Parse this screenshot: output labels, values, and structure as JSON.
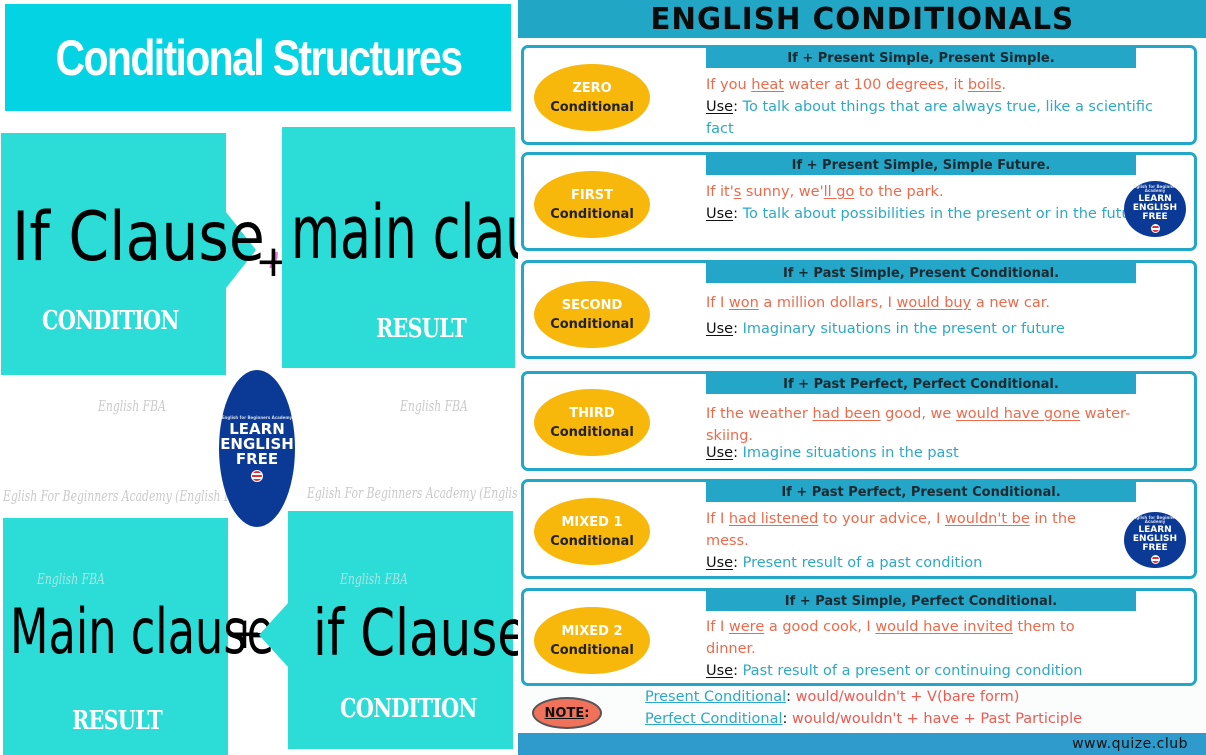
{
  "left": {
    "title": "Conditional Structures",
    "top_row": {
      "if_clause": "If Clause",
      "comma": ",",
      "plus": "+",
      "main_clause": "main clause.",
      "if_tag": "CONDITION",
      "main_tag": "RESULT"
    },
    "bottom_row": {
      "main_clause": "Main clause",
      "plus": "+",
      "if_clause": "if Clause .",
      "main_tag": "RESULT",
      "if_tag": "CONDITION"
    },
    "watermarks": {
      "short": "English FBA",
      "long": "Eglish For Beginners Academy (English FBA)"
    },
    "badge": {
      "tiny": "English for Beginners Academy",
      "line1": "LEARN",
      "line2": "ENGLISH",
      "line3": "FREE"
    }
  },
  "right": {
    "header": "ENGLISH CONDITIONALS",
    "use_label": "Use",
    "cards": [
      {
        "name": "zero",
        "type": "ZERO",
        "label": "Conditional",
        "formula": "If + Present Simple, Present Simple.",
        "example": [
          {
            "t": "If you "
          },
          {
            "t": "heat",
            "u": true
          },
          {
            "t": " water at 100 degrees, it "
          },
          {
            "t": "boils",
            "u": true
          },
          {
            "t": "."
          }
        ],
        "use": "To talk about things that are always true, like a scientific fact"
      },
      {
        "name": "first",
        "type": "FIRST",
        "label": "Conditional",
        "formula": "If + Present Simple, Simple Future.",
        "example": [
          {
            "t": "If it'"
          },
          {
            "t": "s",
            "u": true
          },
          {
            "t": " sunny, we'"
          },
          {
            "t": "ll go",
            "u": true
          },
          {
            "t": " to the park."
          }
        ],
        "use": "To talk about possibilities in the present or in the future"
      },
      {
        "name": "second",
        "type": "SECOND",
        "label": "Conditional",
        "formula": "If + Past Simple, Present Conditional.",
        "example": [
          {
            "t": "If I "
          },
          {
            "t": "won",
            "u": true
          },
          {
            "t": " a million dollars, I "
          },
          {
            "t": "would buy",
            "u": true
          },
          {
            "t": " a new car."
          }
        ],
        "use": "Imaginary situations in the present or future"
      },
      {
        "name": "third",
        "type": "THIRD",
        "label": "Conditional",
        "formula": "If + Past Perfect, Perfect Conditional.",
        "example": [
          {
            "t": "If the weather "
          },
          {
            "t": "had been",
            "u": true
          },
          {
            "t": " good, we "
          },
          {
            "t": "would have gone",
            "u": true
          },
          {
            "t": " water-skiing."
          }
        ],
        "use": "Imagine situations in the past"
      },
      {
        "name": "mixed-1",
        "type": "MIXED 1",
        "label": "Conditional",
        "formula": "If + Past Perfect, Present Conditional.",
        "example": [
          {
            "t": "If I "
          },
          {
            "t": "had listened",
            "u": true
          },
          {
            "t": " to your advice, I "
          },
          {
            "t": "wouldn't be",
            "u": true
          },
          {
            "t": " in the mess."
          }
        ],
        "use": "Present result of a past condition"
      },
      {
        "name": "mixed-2",
        "type": "MIXED 2",
        "label": "Conditional",
        "formula": "If + Past Simple, Perfect Conditional.",
        "example": [
          {
            "t": "If I "
          },
          {
            "t": "were",
            "u": true
          },
          {
            "t": " a good cook, I "
          },
          {
            "t": "would have invited",
            "u": true
          },
          {
            "t": " them to dinner."
          }
        ],
        "use": "Past result of a present or continuing condition"
      }
    ],
    "note": {
      "label": "NOTE",
      "lines": [
        {
          "term": "Present Conditional",
          "text": " would/wouldn't + V(bare form)"
        },
        {
          "term": "Perfect Conditional",
          "text": " would/wouldn't + have + Past Participle"
        }
      ]
    },
    "footer": "www.quize.club"
  },
  "colors": {
    "title_cyan": "#03d3e3",
    "tile_teal": "#2cdcd6",
    "header_blue": "#22a6c6",
    "oval_yellow": "#f8b70b",
    "example_red": "#ec6a4c",
    "use_blue": "#2ea8c4",
    "badge_navy": "#0b3a96",
    "note_oval": "#f0725a",
    "comma_pink": "#e57ad6"
  }
}
